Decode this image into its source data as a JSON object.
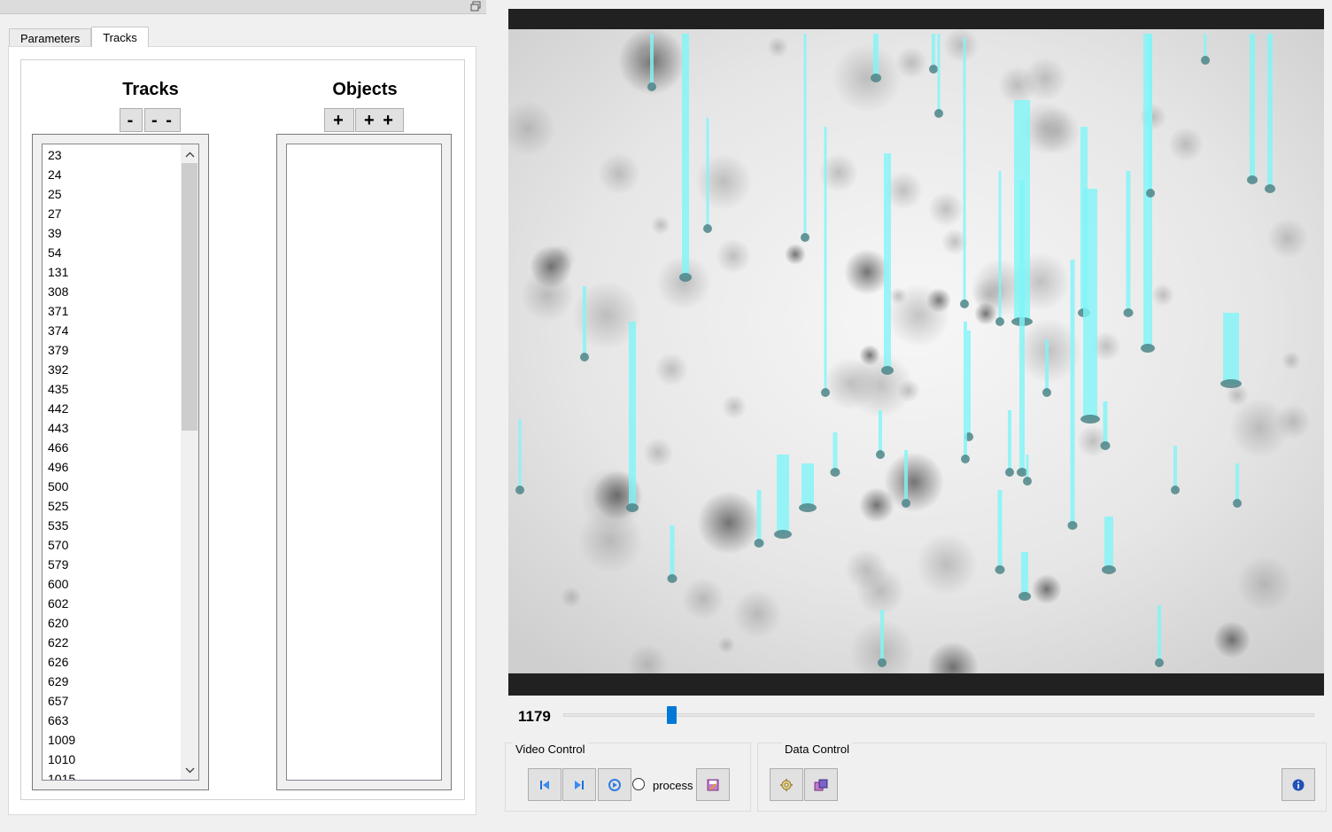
{
  "tabs": [
    {
      "label": "Parameters",
      "active": false
    },
    {
      "label": "Tracks",
      "active": true
    }
  ],
  "tracks_panel": {
    "title": "Tracks",
    "remove_label": "-",
    "remove_all_label": "- -",
    "items": [
      "23",
      "24",
      "25",
      "27",
      "39",
      "54",
      "131",
      "308",
      "371",
      "374",
      "379",
      "392",
      "435",
      "442",
      "443",
      "466",
      "496",
      "500",
      "525",
      "535",
      "570",
      "579",
      "600",
      "602",
      "620",
      "622",
      "626",
      "629",
      "657",
      "663",
      "1009",
      "1010",
      "1015"
    ]
  },
  "objects_panel": {
    "title": "Objects",
    "add_label": "+",
    "add_all_label": "+ +",
    "items": []
  },
  "video": {
    "frame_number": "1179",
    "slider_fraction": 0.14
  },
  "video_control": {
    "title": "Video Control",
    "process_label": "process",
    "process_checked": false
  },
  "data_control": {
    "title": "Data Control"
  },
  "colors": {
    "accent": "#0078d7",
    "track_overlay": "#7ff5f8",
    "video_border": "#212121"
  },
  "icons": {
    "first_frame": "skip-back-icon",
    "next_frame": "skip-forward-icon",
    "play": "play-loop-icon",
    "save": "save-image-icon",
    "settings": "gear-icon",
    "export": "export-data-icon",
    "info": "info-icon"
  }
}
